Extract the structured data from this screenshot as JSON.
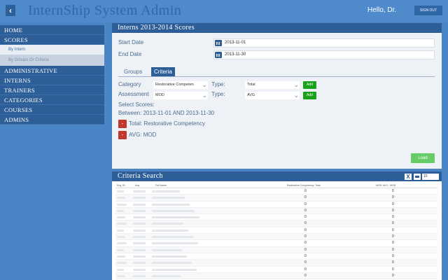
{
  "header": {
    "title": "InternShip System Admin",
    "greeting": "Hello, Dr.",
    "signout_label": "SIGN OUT",
    "back_icon": "chevron-left-icon"
  },
  "sidebar": {
    "items": [
      {
        "label": "HOME"
      },
      {
        "label": "SCORES"
      },
      {
        "label": "ADMINISTRATIVE"
      },
      {
        "label": "INTERNS"
      },
      {
        "label": "TRAINERS"
      },
      {
        "label": "CATEGORIES"
      },
      {
        "label": "COURSES"
      },
      {
        "label": "ADMINS"
      }
    ],
    "subitems": [
      {
        "label": "By Intern"
      },
      {
        "label": "By Groups Or Criteria"
      }
    ]
  },
  "scores_panel": {
    "title": "Interns 2013-2014 Scores",
    "start_label": "Start Date",
    "start_value": "2013-11-01",
    "end_label": "End Date",
    "end_value": "2013-11-30",
    "tabs": [
      {
        "label": "Groups"
      },
      {
        "label": "Criteria"
      }
    ],
    "category_label": "Category",
    "category_value": "Restorative Competen",
    "type_label": "Type:",
    "type1_value": "Total",
    "assessment_label": "Assessment",
    "assessment_value": "MOD",
    "type2_value": "AVG",
    "add_label": "Add",
    "select_scores_label": "Select Scores:",
    "between_text": "Between: 2013-11-01 AND 2013-11-30",
    "selected": [
      {
        "text": "Total: Restorative Competency"
      },
      {
        "text": "AVG: MOD"
      }
    ],
    "delete_label": "-",
    "load_label": "Load"
  },
  "criteria_panel": {
    "title": "Criteria Search",
    "per_page": "10",
    "columns": [
      "Eng. ID",
      "Avg",
      "Full Name",
      "Restorative Competency: Total",
      "MOD: AVG ‑ MOD"
    ],
    "rows": [
      {
        "c1": "0",
        "c2": "0"
      },
      {
        "c1": "0",
        "c2": "0"
      },
      {
        "c1": "0",
        "c2": "0"
      },
      {
        "c1": "0",
        "c2": "0"
      },
      {
        "c1": "0",
        "c2": "0"
      },
      {
        "c1": "0",
        "c2": "0"
      },
      {
        "c1": "0",
        "c2": "0"
      },
      {
        "c1": "0",
        "c2": "0"
      },
      {
        "c1": "0",
        "c2": "0"
      },
      {
        "c1": "0",
        "c2": "0"
      },
      {
        "c1": "0",
        "c2": "0"
      },
      {
        "c1": "0",
        "c2": "0"
      },
      {
        "c1": "0",
        "c2": "0"
      },
      {
        "c1": "0",
        "c2": "0"
      }
    ]
  }
}
